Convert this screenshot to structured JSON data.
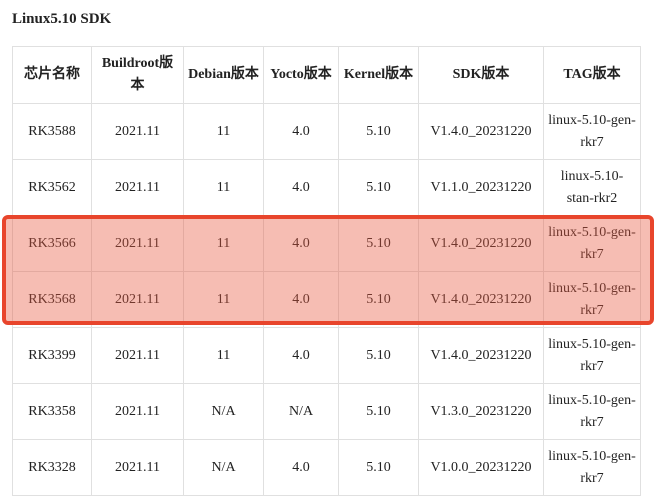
{
  "title": "Linux5.10 SDK",
  "table": {
    "headers": [
      "芯片名称",
      "Buildroot版本",
      "Debian版本",
      "Yocto版本",
      "Kernel版本",
      "SDK版本",
      "TAG版本"
    ],
    "rows": [
      [
        "RK3588",
        "2021.11",
        "11",
        "4.0",
        "5.10",
        "V1.4.0_20231220",
        "linux-5.10-gen-rkr7"
      ],
      [
        "RK3562",
        "2021.11",
        "11",
        "4.0",
        "5.10",
        "V1.1.0_20231220",
        "linux-5.10-stan-rkr2"
      ],
      [
        "RK3566",
        "2021.11",
        "11",
        "4.0",
        "5.10",
        "V1.4.0_20231220",
        "linux-5.10-gen-rkr7"
      ],
      [
        "RK3568",
        "2021.11",
        "11",
        "4.0",
        "5.10",
        "V1.4.0_20231220",
        "linux-5.10-gen-rkr7"
      ],
      [
        "RK3399",
        "2021.11",
        "11",
        "4.0",
        "5.10",
        "V1.4.0_20231220",
        "linux-5.10-gen-rkr7"
      ],
      [
        "RK3358",
        "2021.11",
        "N/A",
        "N/A",
        "5.10",
        "V1.3.0_20231220",
        "linux-5.10-gen-rkr7"
      ],
      [
        "RK3328",
        "2021.11",
        "N/A",
        "4.0",
        "5.10",
        "V1.0.0_20231220",
        "linux-5.10-gen-rkr7"
      ]
    ]
  },
  "highlight": {
    "rows": [
      "RK3566",
      "RK3568"
    ],
    "color": "#e8452c"
  }
}
